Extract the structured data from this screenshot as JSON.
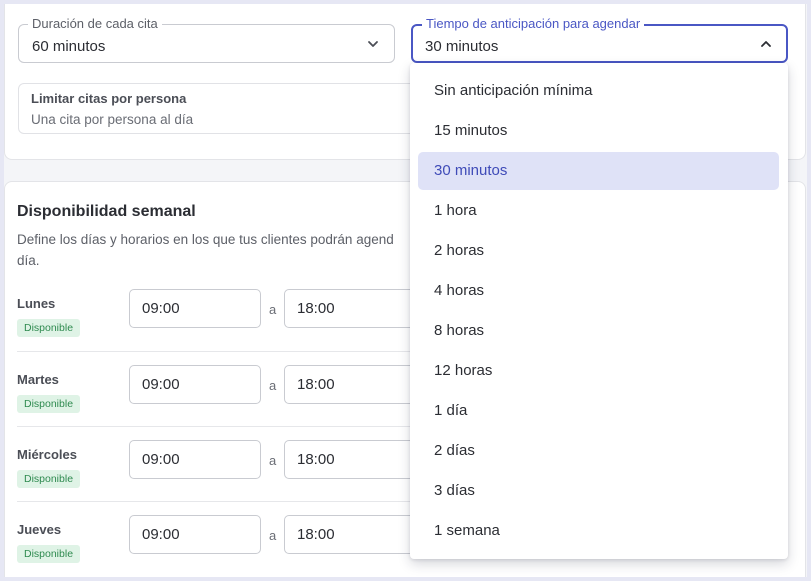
{
  "duration": {
    "label": "Duración de cada cita",
    "value": "60 minutos"
  },
  "advance": {
    "label": "Tiempo de anticipación para agendar",
    "value": "30 minutos"
  },
  "limit": {
    "title": "Limitar citas por persona",
    "subtitle": "Una cita por persona al día"
  },
  "weekly": {
    "title": "Disponibilidad semanal",
    "description": "Define los días y horarios en los que tus clientes podrán agend",
    "description_cont": "día.",
    "separator": "a",
    "days": [
      {
        "name": "Lunes",
        "status": "Disponible",
        "start": "09:00",
        "end": "18:00"
      },
      {
        "name": "Martes",
        "status": "Disponible",
        "start": "09:00",
        "end": "18:00"
      },
      {
        "name": "Miércoles",
        "status": "Disponible",
        "start": "09:00",
        "end": "18:00"
      },
      {
        "name": "Jueves",
        "status": "Disponible",
        "start": "09:00",
        "end": "18:00"
      }
    ]
  },
  "menu": {
    "options": [
      "Sin anticipación mínima",
      "15 minutos",
      "30 minutos",
      "1 hora",
      "2 horas",
      "4 horas",
      "8 horas",
      "12 horas",
      "1 día",
      "2 días",
      "3 días",
      "1 semana"
    ],
    "selected_index": 2
  },
  "colors": {
    "accent": "#4a57c4",
    "selected_bg": "#dfe2f7",
    "badge_bg": "#dff3e6",
    "badge_text": "#2e8a4f"
  },
  "icons": {
    "closed_select": "chevron-down-icon",
    "open_select": "chevron-up-icon"
  }
}
